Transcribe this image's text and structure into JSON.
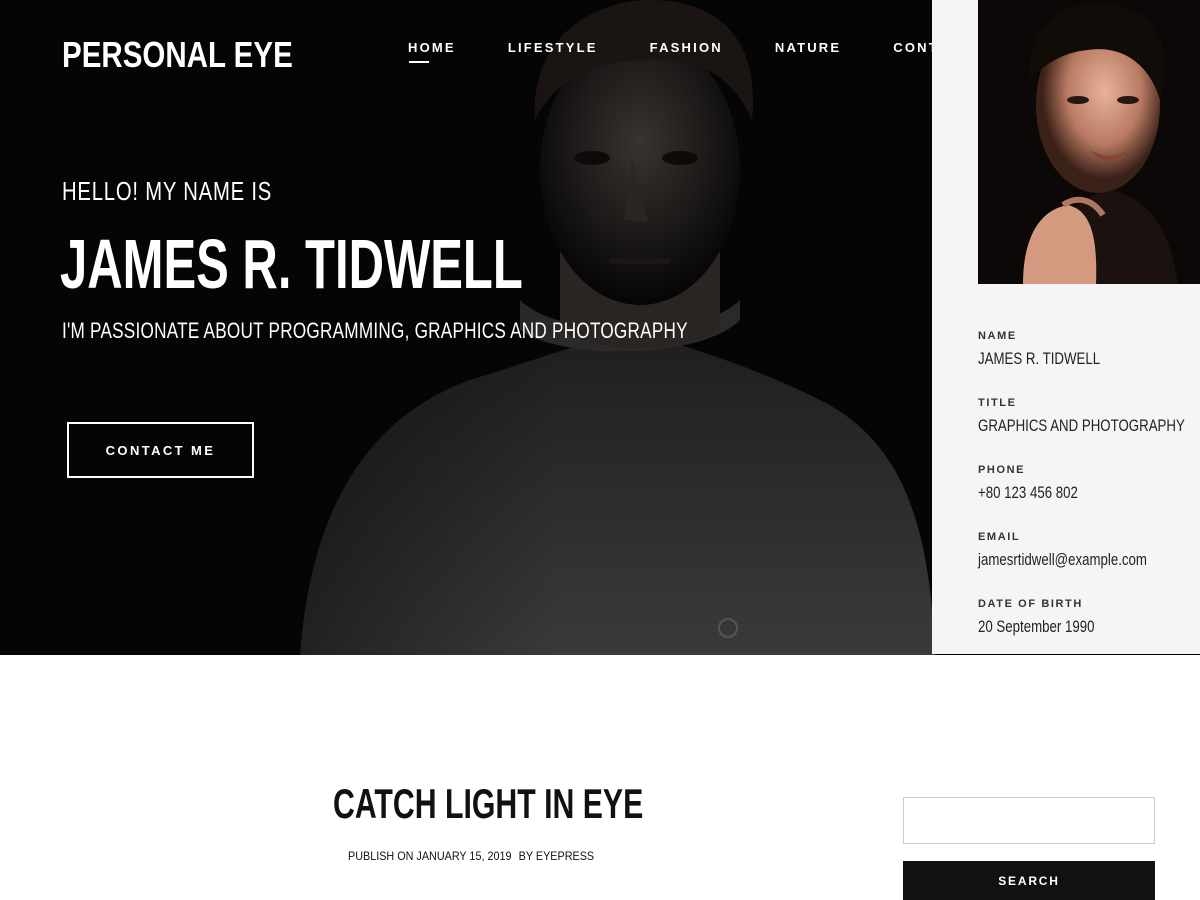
{
  "site": {
    "brand": "PERSONAL EYE"
  },
  "nav": {
    "items": [
      {
        "label": "HOME",
        "active": true
      },
      {
        "label": "LIFESTYLE"
      },
      {
        "label": "FASHION"
      },
      {
        "label": "NATURE"
      },
      {
        "label": "CONTACT"
      }
    ]
  },
  "hero": {
    "greeting": "HELLO! MY NAME IS",
    "name": "JAMES R. TIDWELL",
    "tagline": "I'M PASSIONATE ABOUT PROGRAMMING, GRAPHICS AND PHOTOGRAPHY",
    "contact_button": "CONTACT ME"
  },
  "profile": {
    "fields": [
      {
        "label": "NAME",
        "value": "JAMES R. TIDWELL"
      },
      {
        "label": "TITLE",
        "value": "GRAPHICS AND PHOTOGRAPHY"
      },
      {
        "label": "PHONE",
        "value": "+80 123 456 802"
      },
      {
        "label": "EMAIL",
        "value": "jamesrtidwell@example.com"
      },
      {
        "label": "DATE OF BIRTH",
        "value": "20 September 1990"
      }
    ]
  },
  "post": {
    "title": "CATCH LIGHT IN EYE",
    "publish": "PUBLISH ON JANUARY 15, 2019",
    "author": "BY EYEPRESS"
  },
  "sidebar": {
    "search_placeholder": "",
    "search_button": "SEARCH"
  }
}
